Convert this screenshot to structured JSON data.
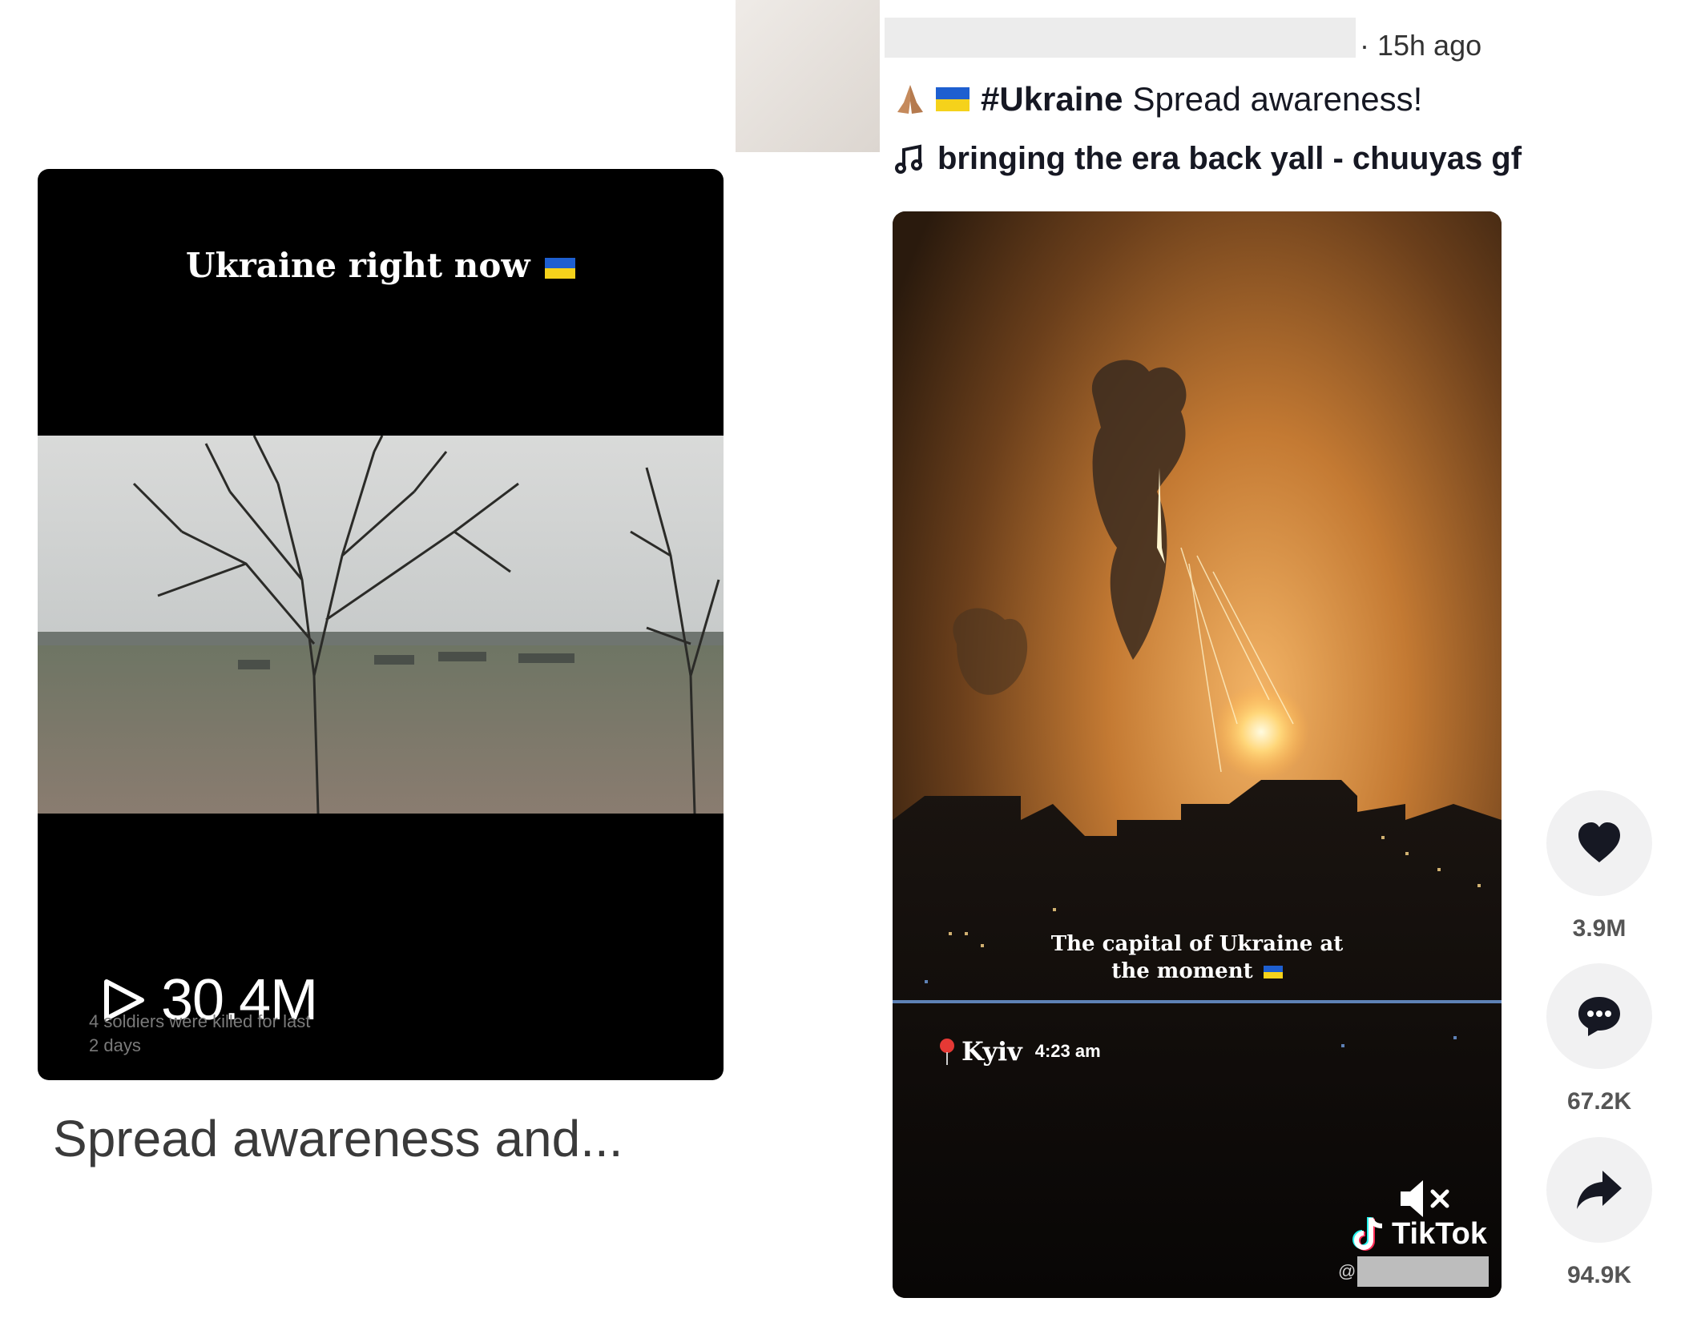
{
  "left_post": {
    "overlay_title": "Ukraine right now",
    "view_count": "30.4M",
    "video_caption_line1": "4 soldiers were killed for last",
    "video_caption_line2": "2 days",
    "description": "Spread awareness and..."
  },
  "right_post": {
    "time_ago": "· 15h ago",
    "caption_hashtag": "#Ukraine",
    "caption_text": "Spread awareness!",
    "music": "bringing the era back yall - chuuyas gf",
    "video_overlay_text": "The capital of Ukraine at the moment",
    "location": "Kyiv",
    "location_time": "4:23 am",
    "watermark": "TikTok",
    "handle_prefix": "@",
    "actions": {
      "likes": "3.9M",
      "comments": "67.2K",
      "shares": "94.9K"
    }
  },
  "icons": [
    "play-icon",
    "pray-emoji-icon",
    "ukraine-flag-icon",
    "music-note-icon",
    "location-pin-icon",
    "mute-icon",
    "tiktok-logo-icon",
    "heart-icon",
    "comment-icon",
    "share-icon"
  ],
  "colors": {
    "flag_blue": "#1e5fd0",
    "flag_yellow": "#f5d21b",
    "action_bg": "#f1f1f2"
  }
}
